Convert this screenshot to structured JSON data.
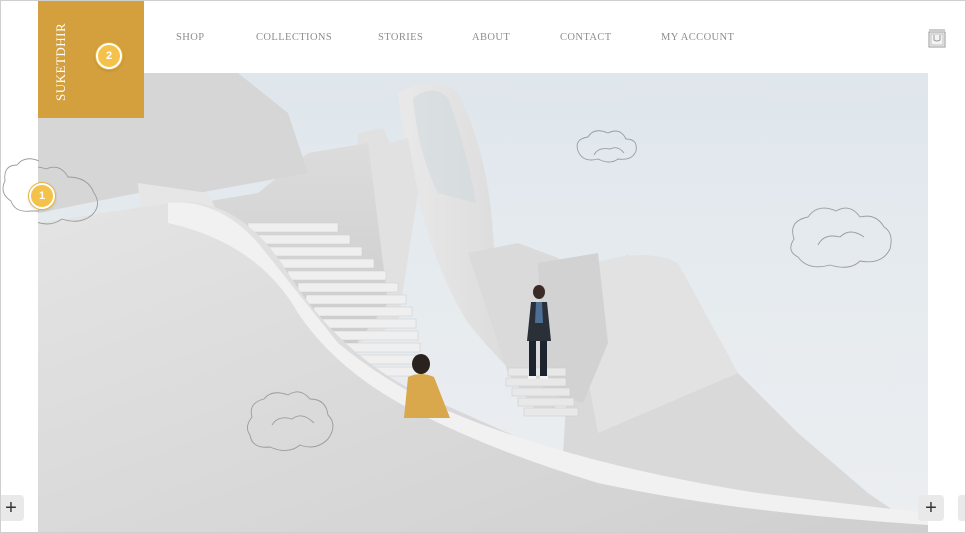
{
  "brand": {
    "logo_text": "SUKETDHIR",
    "accent_color": "#d4a03e"
  },
  "nav": {
    "items": [
      {
        "label": "SHOP"
      },
      {
        "label": "COLLECTIONS"
      },
      {
        "label": "STORIES"
      },
      {
        "label": "ABOUT"
      },
      {
        "label": "CONTACT"
      },
      {
        "label": "MY ACCOUNT"
      }
    ],
    "cart_icon": "shopping-bag-icon"
  },
  "markers": [
    {
      "label": "1",
      "color": "#f4c24a"
    },
    {
      "label": "2",
      "color": "#f4c24a"
    }
  ],
  "controls": {
    "zoom_in_left": "+",
    "zoom_in_right": "+"
  },
  "hero": {
    "image_subject": "white sculptural staircase with two people, cloud doodles",
    "sky_color": "#dfe6ec"
  }
}
